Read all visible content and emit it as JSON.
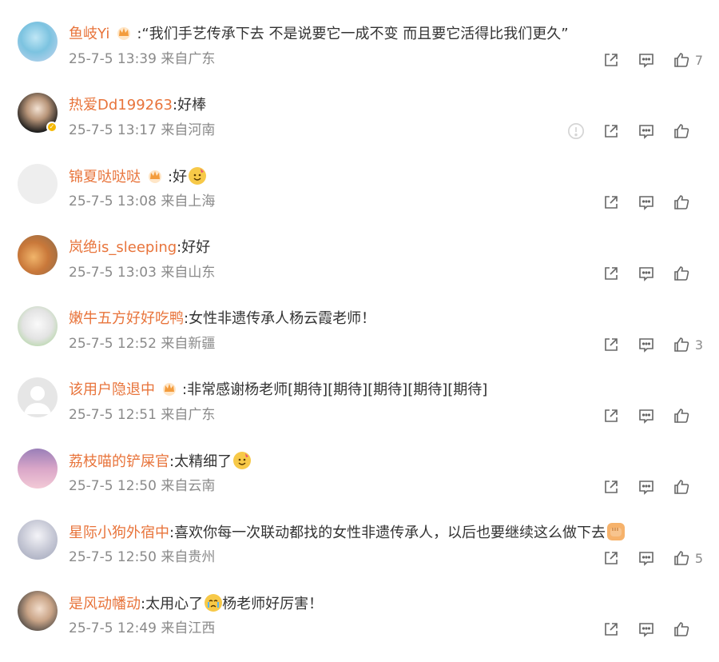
{
  "comments": [
    {
      "user": "鱼岐Yi",
      "crown": true,
      "text": ":“我们手艺传承下去 不是说要它一成不变 而且要它活得比我们更久”",
      "time": "25-7-5 13:39",
      "location": "来自广东",
      "likes": "7",
      "emoji": ""
    },
    {
      "user": "热爱Dd199263",
      "crown": false,
      "text": ":好棒",
      "time": "25-7-5 13:17",
      "location": "来自河南",
      "likes": "",
      "emoji": ""
    },
    {
      "user": "锦夏哒哒哒",
      "crown": true,
      "text": ":好",
      "time": "25-7-5 13:08",
      "location": "来自上海",
      "likes": "",
      "emoji": "party-face"
    },
    {
      "user": "岚绝is_sleeping",
      "crown": false,
      "text": ":好好",
      "time": "25-7-5 13:03",
      "location": "来自山东",
      "likes": "",
      "emoji": ""
    },
    {
      "user": "嫩牛五方好好吃鸭",
      "crown": false,
      "text": ":女性非遗传承人杨云霞老师！",
      "time": "25-7-5 12:52",
      "location": "来自新疆",
      "likes": "3",
      "emoji": ""
    },
    {
      "user": "该用户隐退中",
      "crown": true,
      "text": ":非常感谢杨老师[期待][期待][期待][期待][期待]",
      "time": "25-7-5 12:51",
      "location": "来自广东",
      "likes": "",
      "emoji": ""
    },
    {
      "user": "荔枝喵的铲屎官",
      "crown": false,
      "text": ":太精细了",
      "time": "25-7-5 12:50",
      "location": "来自云南",
      "likes": "",
      "emoji": "party-face"
    },
    {
      "user": "星际小狗外宿中",
      "crown": false,
      "text": ":喜欢你每一次联动都找的女性非遗传承人，以后也要继续这么做下去",
      "time": "25-7-5 12:50",
      "location": "来自贵州",
      "likes": "5",
      "emoji": "fist"
    },
    {
      "user": "是风动幡动",
      "crown": false,
      "text": ":太用心了",
      "text2": "杨老师好厉害！",
      "time": "25-7-5 12:49",
      "location": "来自江西",
      "likes": "",
      "emoji": "crying-face"
    }
  ],
  "colors": {
    "username": "#e8743b",
    "meta": "#8a8a8a",
    "icon": "#666666"
  }
}
